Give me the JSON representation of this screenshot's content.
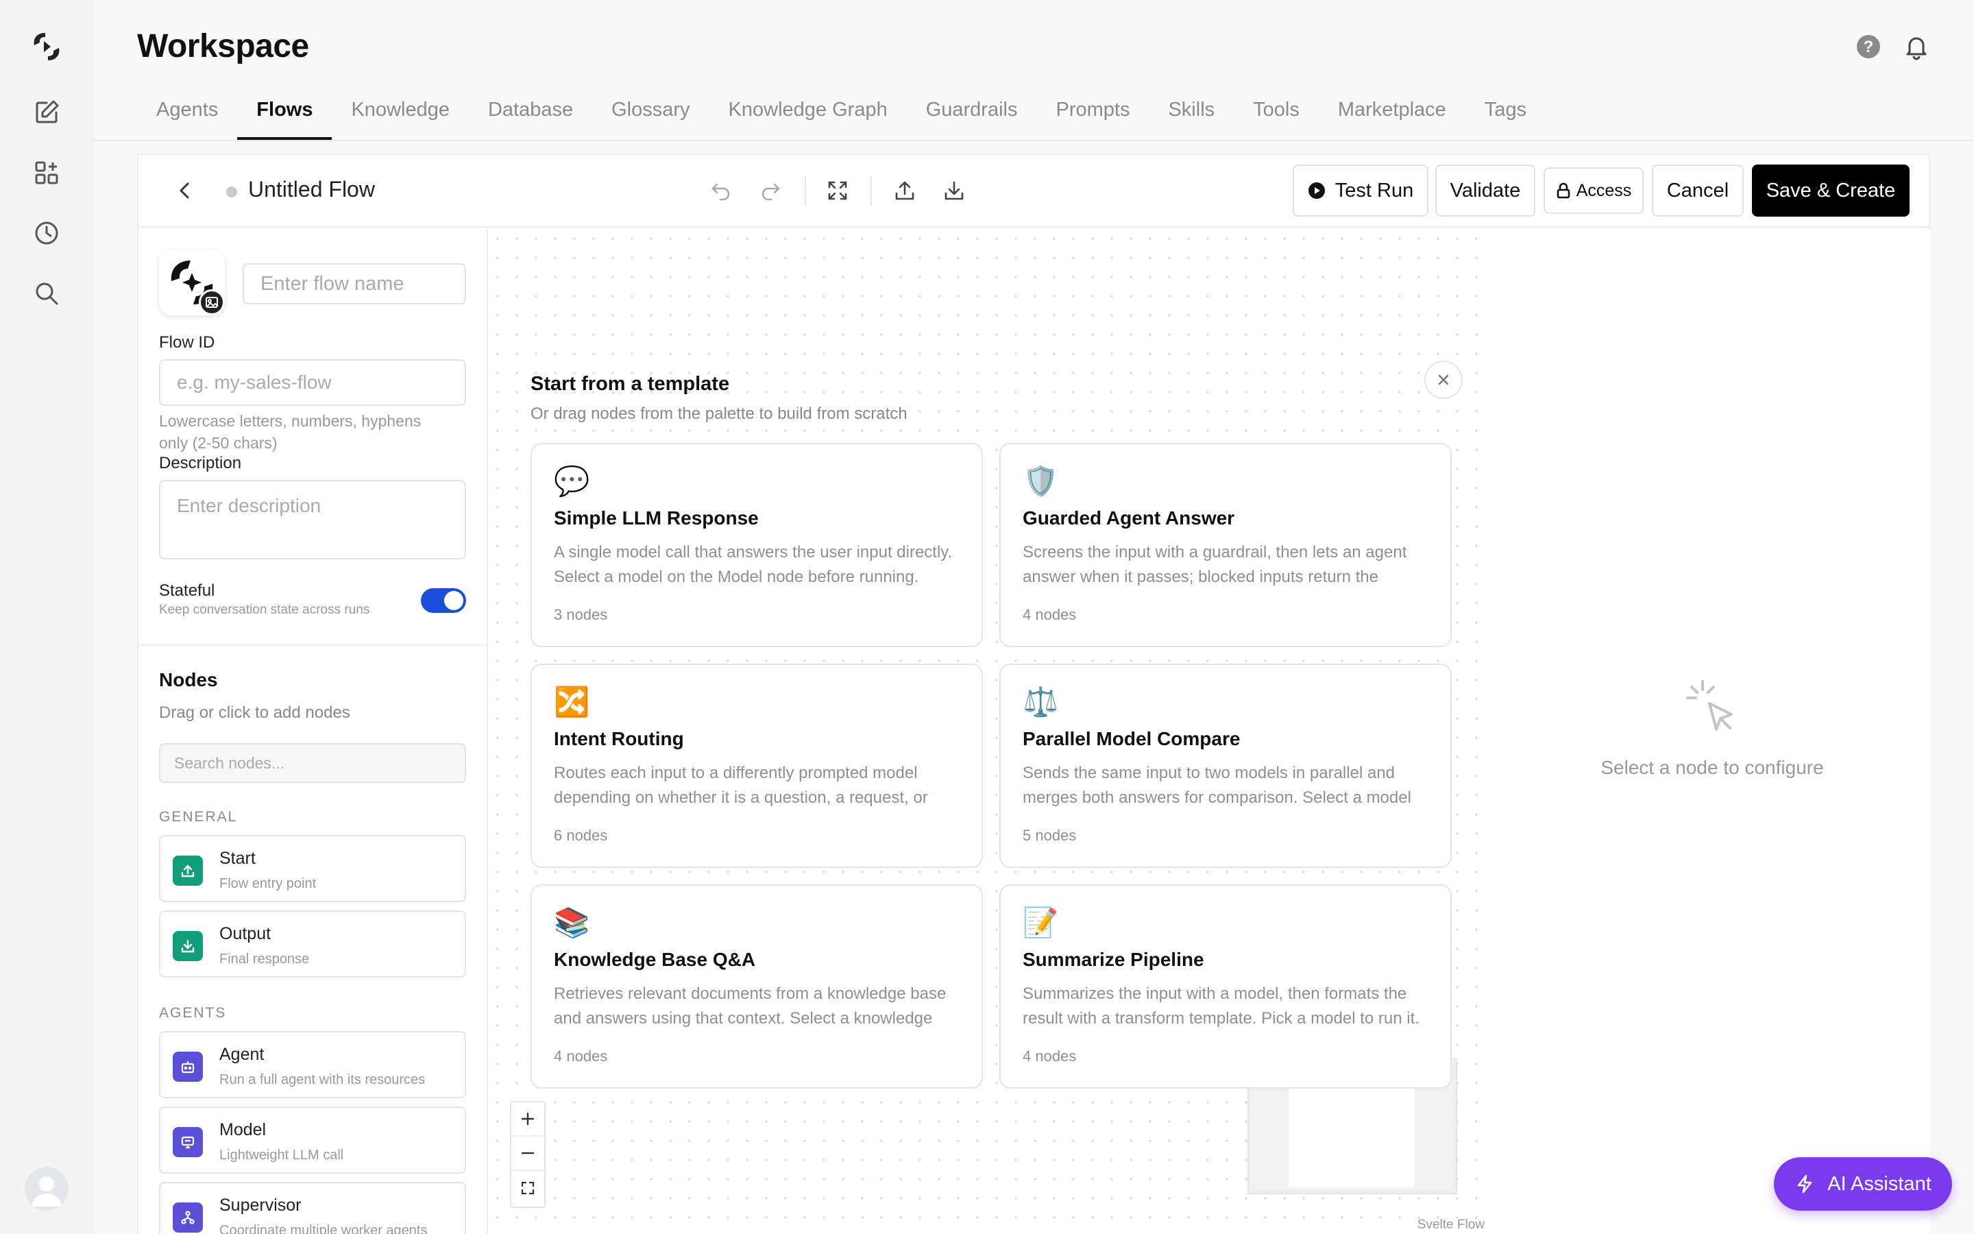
{
  "rail": {
    "icons": [
      "logo-icon",
      "edit-icon",
      "apps-icon",
      "history-icon",
      "search-icon"
    ]
  },
  "header": {
    "title": "Workspace",
    "tabs": [
      "Agents",
      "Flows",
      "Knowledge",
      "Database",
      "Glossary",
      "Knowledge Graph",
      "Guardrails",
      "Prompts",
      "Skills",
      "Tools",
      "Marketplace",
      "Tags"
    ],
    "active_tab": "Flows"
  },
  "toolbar": {
    "flow_title": "Untitled Flow",
    "test_run": "Test Run",
    "validate": "Validate",
    "access": "Access",
    "cancel": "Cancel",
    "save": "Save & Create"
  },
  "form": {
    "name_placeholder": "Enter flow name",
    "flow_id_label": "Flow ID",
    "flow_id_placeholder": "e.g. my-sales-flow",
    "flow_id_hint_1": "Lowercase letters, numbers, hyphens",
    "flow_id_hint_2": "only (2-50 chars)",
    "description_label": "Description",
    "description_placeholder": "Enter description",
    "stateful_label": "Stateful",
    "stateful_hint": "Keep conversation state across runs",
    "stateful_on": true
  },
  "nodes_panel": {
    "title": "Nodes",
    "subtitle": "Drag or click to add nodes",
    "search_placeholder": "Search nodes...",
    "general_label": "GENERAL",
    "agents_label": "AGENTS",
    "general": [
      {
        "name": "Start",
        "desc": "Flow entry point",
        "color": "#0f9d7a"
      },
      {
        "name": "Output",
        "desc": "Final response",
        "color": "#0f9d7a"
      }
    ],
    "agents": [
      {
        "name": "Agent",
        "desc": "Run a full agent with its resources",
        "color": "#5b4fd6"
      },
      {
        "name": "Model",
        "desc": "Lightweight LLM call",
        "color": "#5b4fd6"
      },
      {
        "name": "Supervisor",
        "desc": "Coordinate multiple worker agents",
        "color": "#5b4fd6"
      }
    ]
  },
  "templates": {
    "title": "Start from a template",
    "subtitle": "Or drag nodes from the palette to build from scratch",
    "cards": [
      {
        "emoji": "💬",
        "title": "Simple LLM Response",
        "desc": "A single model call that answers the user input directly. Select a model on the Model node before running.",
        "nodes": "3 nodes"
      },
      {
        "emoji": "🛡️",
        "title": "Guarded Agent Answer",
        "desc": "Screens the input with a guardrail, then lets an agent answer when it passes; blocked inputs return the guardrail message.",
        "nodes": "4 nodes"
      },
      {
        "emoji": "🔀",
        "title": "Intent Routing",
        "desc": "Routes each input to a differently prompted model depending on whether it is a question, a request, or something else.",
        "nodes": "6 nodes"
      },
      {
        "emoji": "⚖️",
        "title": "Parallel Model Compare",
        "desc": "Sends the same input to two models in parallel and merges both answers for comparison. Select a model on each Model node.",
        "nodes": "5 nodes"
      },
      {
        "emoji": "📚",
        "title": "Knowledge Base Q&A",
        "desc": "Retrieves relevant documents from a knowledge base and answers using that context. Select a knowledge base and model.",
        "nodes": "4 nodes"
      },
      {
        "emoji": "📝",
        "title": "Summarize Pipeline",
        "desc": "Summarizes the input with a model, then formats the result with a transform template. Pick a model to run it.",
        "nodes": "4 nodes"
      }
    ]
  },
  "canvas": {
    "attribution": "Svelte Flow"
  },
  "config_panel": {
    "empty_text": "Select a node to configure"
  },
  "assistant": {
    "label": "AI Assistant",
    "color": "#7c3aed"
  }
}
